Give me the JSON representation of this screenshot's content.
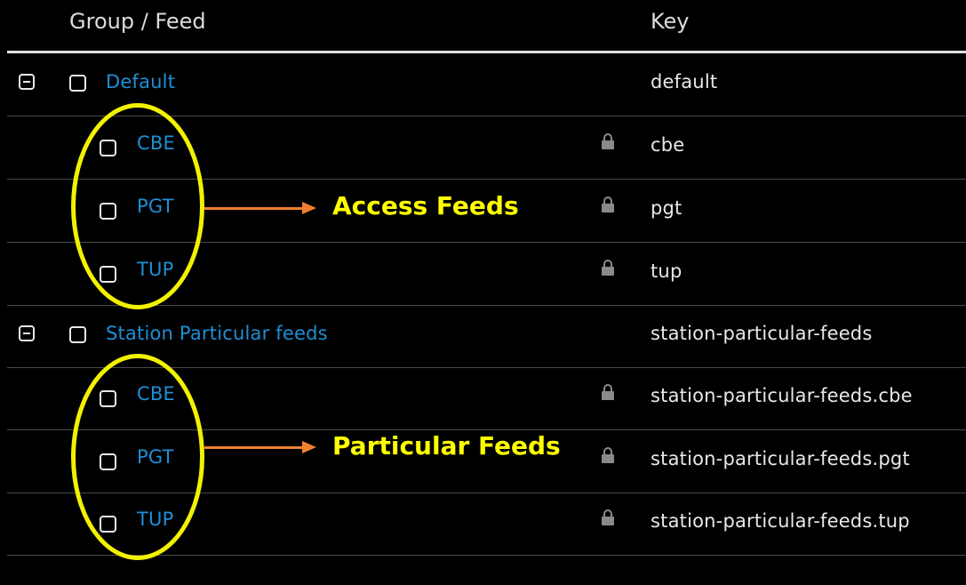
{
  "header": {
    "group_feed": "Group / Feed",
    "key": "Key"
  },
  "groups": [
    {
      "name": "Default",
      "key": "default",
      "feeds": [
        {
          "name": "CBE",
          "key": "cbe"
        },
        {
          "name": "PGT",
          "key": "pgt"
        },
        {
          "name": "TUP",
          "key": "tup"
        }
      ]
    },
    {
      "name": "Station Particular feeds",
      "key": "station-particular-feeds",
      "feeds": [
        {
          "name": "CBE",
          "key": "station-particular-feeds.cbe"
        },
        {
          "name": "PGT",
          "key": "station-particular-feeds.pgt"
        },
        {
          "name": "TUP",
          "key": "station-particular-feeds.tup"
        }
      ]
    }
  ],
  "annotations": {
    "access": "Access Feeds",
    "particular": "Particular Feeds"
  },
  "icons": {
    "collapse": "collapse-minus-icon",
    "checkbox": "checkbox-icon",
    "lock": "lock-icon"
  },
  "colors": {
    "link": "#1e8fd6",
    "annotation_text": "#ffff00",
    "annotation_ellipse": "#f2f200",
    "arrow": "#f08030"
  }
}
